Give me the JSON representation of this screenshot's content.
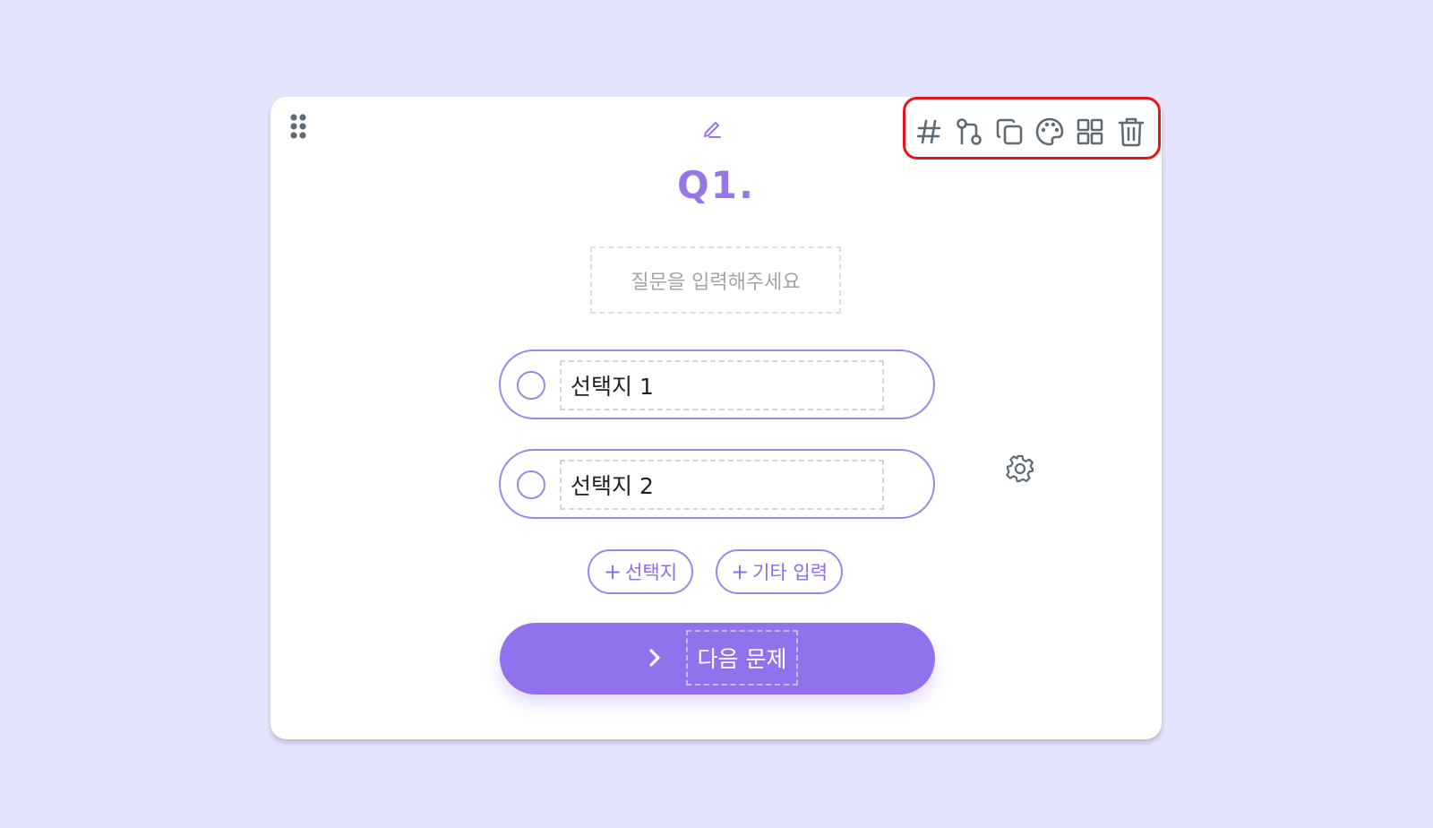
{
  "card": {
    "question_number": "Q1.",
    "question_placeholder": "질문을 입력해주세요",
    "toolbar": {
      "icons": [
        "hash-icon",
        "branch-icon",
        "copy-icon",
        "palette-icon",
        "grid-icon",
        "trash-icon"
      ]
    },
    "choices": [
      {
        "label": "선택지 1"
      },
      {
        "label": "선택지 2"
      }
    ],
    "add_choice_button": "선택지",
    "add_other_button": "기타 입력",
    "plus_symbol": "+",
    "next_button": "다음 문제"
  },
  "colors": {
    "background": "#e4e4fe",
    "accent": "#9171ec",
    "highlight_border": "#e8141b",
    "icon_gray": "#5f6b74"
  }
}
